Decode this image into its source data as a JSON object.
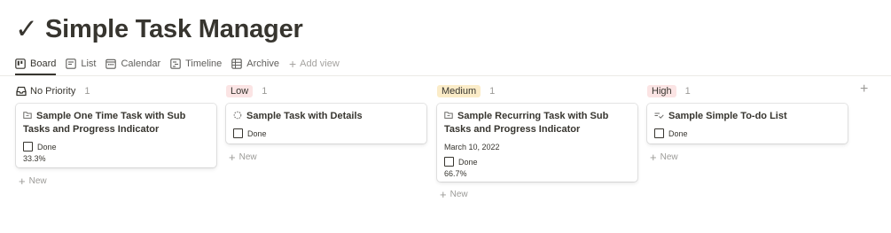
{
  "page": {
    "title": "Simple Task Manager",
    "title_icon": "check-icon"
  },
  "views": [
    {
      "label": "Board",
      "icon": "board-icon",
      "active": true
    },
    {
      "label": "List",
      "icon": "list-icon"
    },
    {
      "label": "Calendar",
      "icon": "calendar-icon"
    },
    {
      "label": "Timeline",
      "icon": "timeline-icon"
    },
    {
      "label": "Archive",
      "icon": "table-icon"
    },
    {
      "label": "Add view",
      "icon": "plus-icon"
    }
  ],
  "colors": {
    "low_tag_bg": "#fbe4e4",
    "medium_tag_bg": "#fbecc8",
    "high_tag_bg": "#fbe4e4",
    "text": "#37352f",
    "muted": "#9b9a97"
  },
  "columns": [
    {
      "label": "No Priority",
      "count": "1",
      "icon": "inbox-icon",
      "cards": [
        {
          "title": "Sample One Time Task with Sub Tasks and Progress Indicator",
          "icon": "folder-icon",
          "done_label": "Done",
          "progress": "33.3%"
        }
      ],
      "new_label": "New"
    },
    {
      "label": "Low",
      "count": "1",
      "cards": [
        {
          "title": "Sample Task with Details",
          "icon": "dashed-circle-icon",
          "done_label": "Done"
        }
      ],
      "new_label": "New"
    },
    {
      "label": "Medium",
      "count": "1",
      "cards": [
        {
          "title": "Sample Recurring Task with Sub Tasks and Progress Indicator",
          "icon": "folder-icon",
          "date": "March 10, 2022",
          "done_label": "Done",
          "progress": "66.7%"
        }
      ],
      "new_label": "New"
    },
    {
      "label": "High",
      "count": "1",
      "cards": [
        {
          "title": "Sample Simple To-do List",
          "icon": "checklist-icon",
          "done_label": "Done"
        }
      ],
      "new_label": "New"
    }
  ],
  "add_group_icon": "plus-icon"
}
